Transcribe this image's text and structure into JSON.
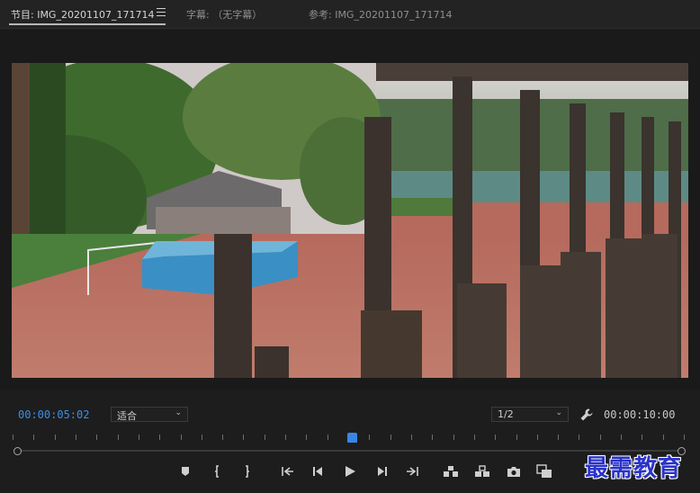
{
  "tabs": [
    {
      "label": "节目: IMG_20201107_171714",
      "active": true
    },
    {
      "label": "字幕: （无字幕）",
      "active": false
    },
    {
      "label": "参考: IMG_20201107_171714",
      "active": false
    }
  ],
  "timecode": {
    "current": "00:00:05:02",
    "duration": "00:00:10:00"
  },
  "zoom_select": {
    "value": "适合"
  },
  "resolution_select": {
    "value": "1/2"
  },
  "playhead_position": 0.503,
  "transport": [
    {
      "name": "add-marker-button",
      "icon": "marker-icon"
    },
    {
      "name": "mark-in-button",
      "icon": "mark-in-icon"
    },
    {
      "name": "mark-out-button",
      "icon": "mark-out-icon"
    },
    {
      "name": "go-to-in-button",
      "icon": "go-to-in-icon"
    },
    {
      "name": "step-back-button",
      "icon": "step-back-icon"
    },
    {
      "name": "play-button",
      "icon": "play-icon"
    },
    {
      "name": "step-forward-button",
      "icon": "step-forward-icon"
    },
    {
      "name": "go-to-out-button",
      "icon": "go-to-out-icon"
    },
    {
      "name": "lift-button",
      "icon": "lift-icon"
    },
    {
      "name": "extract-button",
      "icon": "extract-icon"
    },
    {
      "name": "export-frame-button",
      "icon": "camera-icon"
    },
    {
      "name": "comparison-view-button",
      "icon": "comparison-icon"
    }
  ],
  "watermark": "最需教育"
}
